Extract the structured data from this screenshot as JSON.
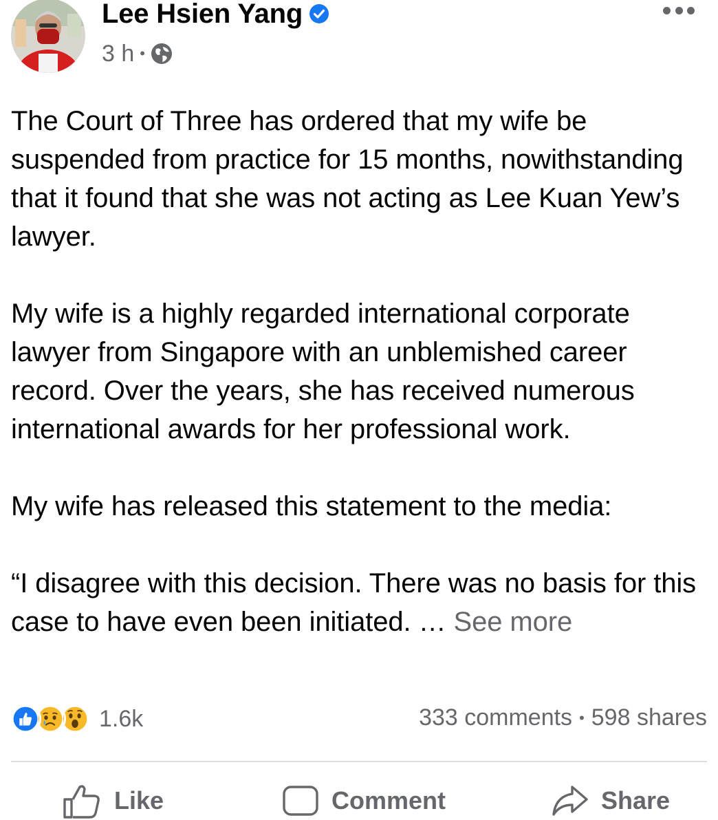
{
  "post": {
    "author": "Lee Hsien Yang",
    "time": "3 h",
    "meta_dot": "•",
    "paragraphs": [
      "The Court of Three has ordered that my wife be suspended from practice for 15 months, nowithstanding that it found that she was not acting as Lee Kuan Yew’s lawyer.",
      "My wife is a highly regarded international corporate lawyer from Singapore with an unblemished career record.  Over the years, she has received numerous international awards for her professional work.",
      "My wife has released this statement to the media:"
    ],
    "quote": "“I disagree with this decision. There was no basis for this case to have even been initiated. … ",
    "see_more": "See more"
  },
  "stats": {
    "reaction_count": "1.6k",
    "reactions": [
      "like-icon",
      "sad-icon",
      "wow-icon"
    ],
    "comments": "333 comments",
    "sep": "•",
    "shares": "598 shares"
  },
  "actions": {
    "like": "Like",
    "comment": "Comment",
    "share": "Share"
  },
  "colors": {
    "text": "#050505",
    "secondary": "#65676b",
    "verified_blue": "#1877f2",
    "divider": "#dadde1"
  }
}
